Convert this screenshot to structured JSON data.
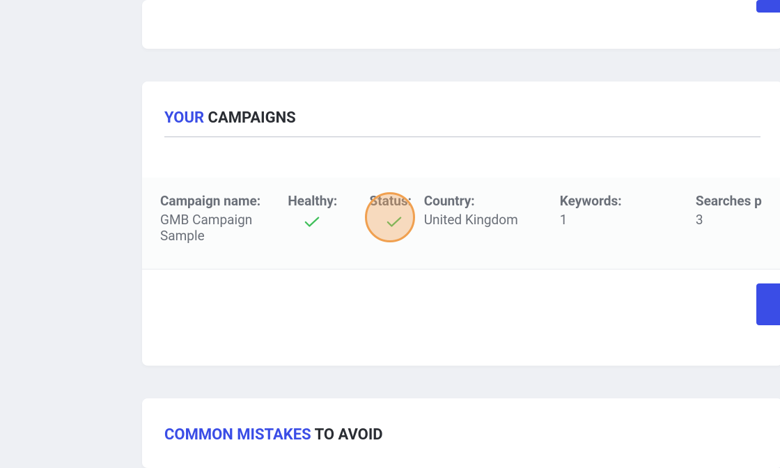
{
  "sections": {
    "campaigns": {
      "title_accent": "YOUR",
      "title_rest": " CAMPAIGNS"
    },
    "mistakes": {
      "title_accent": "COMMON MISTAKES",
      "title_rest": " TO AVOID"
    }
  },
  "table": {
    "headers": {
      "name": "Campaign name:",
      "healthy": "Healthy:",
      "status": "Status:",
      "country": "Country:",
      "keywords": "Keywords:",
      "searches": "Searches p"
    },
    "row": {
      "name": "GMB Campaign Sample",
      "healthy_icon": "check",
      "status_icon": "check",
      "country": "United Kingdom",
      "keywords": "1",
      "searches": "3"
    }
  },
  "colors": {
    "check_stroke": "#3fbf5a"
  }
}
